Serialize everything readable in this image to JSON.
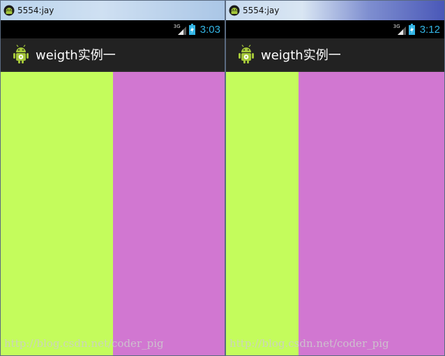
{
  "emulators": [
    {
      "window_title": "5554:jay",
      "status": {
        "network": "3G",
        "clock": "3:03"
      },
      "app_title": "weigth实例一",
      "panes": [
        {
          "name": "green-pane",
          "color": "#c4fc5c",
          "weight": 1
        },
        {
          "name": "purple-pane",
          "color": "#d177d1",
          "weight": 1
        }
      ],
      "watermark": "http://blog.csdn.net/coder_pig"
    },
    {
      "window_title": "5554:jay",
      "status": {
        "network": "3G",
        "clock": "3:12"
      },
      "app_title": "weigth实例一",
      "panes": [
        {
          "name": "green-pane",
          "color": "#c4fc5c",
          "weight": 1
        },
        {
          "name": "purple-pane",
          "color": "#d177d1",
          "weight": 2
        }
      ],
      "watermark": "http://blog.csdn.net/coder_pig"
    }
  ],
  "colors": {
    "clock": "#33b5e5",
    "action_bar": "#222222",
    "status_bar": "#000000"
  },
  "icons": {
    "window": "android-emulator-icon",
    "app": "android-robot-icon",
    "signal": "signal-strength-icon",
    "battery": "battery-charging-icon"
  }
}
